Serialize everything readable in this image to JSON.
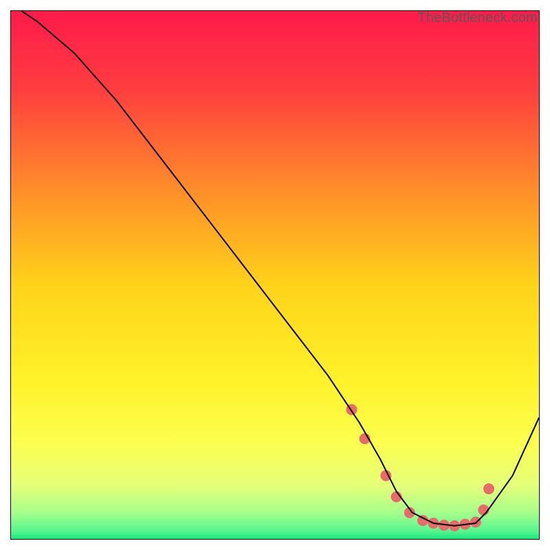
{
  "watermark": "TheBottleneck.com",
  "chart_data": {
    "type": "line",
    "title": "",
    "xlabel": "",
    "ylabel": "",
    "xlim": [
      0,
      100
    ],
    "ylim": [
      0,
      100
    ],
    "grid": false,
    "legend": false,
    "gradient_stops": [
      {
        "offset": 0.0,
        "color": "#ff1a4b"
      },
      {
        "offset": 0.15,
        "color": "#ff3e3f"
      },
      {
        "offset": 0.33,
        "color": "#ff8a2a"
      },
      {
        "offset": 0.52,
        "color": "#ffd31a"
      },
      {
        "offset": 0.7,
        "color": "#fff22a"
      },
      {
        "offset": 0.82,
        "color": "#fbff4f"
      },
      {
        "offset": 0.9,
        "color": "#e4ff7a"
      },
      {
        "offset": 0.95,
        "color": "#a6ff8a"
      },
      {
        "offset": 0.985,
        "color": "#57f590"
      },
      {
        "offset": 1.0,
        "color": "#17e87a"
      }
    ],
    "series": [
      {
        "name": "bottleneck-curve",
        "color": "#000000",
        "x": [
          2,
          5,
          12,
          20,
          30,
          40,
          50,
          60,
          66,
          70,
          73,
          76,
          80,
          84,
          88,
          90,
          95,
          100
        ],
        "y": [
          100,
          98,
          92,
          83,
          70,
          57,
          44,
          31,
          22,
          15,
          9,
          5,
          3,
          2.5,
          3,
          5,
          12,
          23
        ]
      }
    ],
    "markers": {
      "name": "highlight-dots",
      "color": "#e96a6a",
      "radius_px": 8,
      "x": [
        64.5,
        67,
        71,
        73,
        75.5,
        78,
        80,
        82,
        84,
        86,
        88,
        89.5,
        90.5
      ],
      "y": [
        24.5,
        19,
        12,
        8,
        5,
        3.5,
        3,
        2.6,
        2.5,
        2.8,
        3.2,
        5.5,
        9.5
      ]
    }
  }
}
